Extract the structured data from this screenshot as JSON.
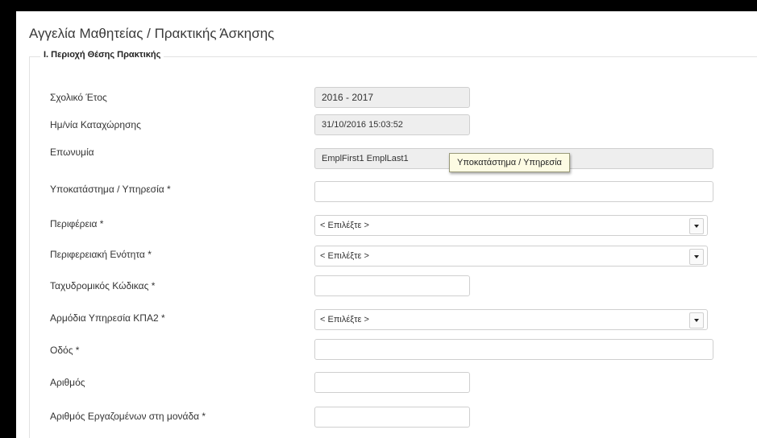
{
  "page_title": "Αγγελία Μαθητείας / Πρακτικής Άσκησης",
  "section": {
    "legend": "I. Περιοχή Θέσης Πρακτικής"
  },
  "fields": {
    "school_year": {
      "label": "Σχολικό Έτος",
      "value": "2016 - 2017"
    },
    "registration_date": {
      "label": "Ημ/νία Καταχώρησης",
      "value": "31/10/2016 15:03:52"
    },
    "company_name": {
      "label": "Επωνυμία",
      "value": "EmplFirst1 EmplLast1"
    },
    "branch": {
      "label": "Υποκατάστημα / Υπηρεσία *",
      "value": ""
    },
    "region": {
      "label": "Περιφέρεια *",
      "value": "< Επιλέξτε >"
    },
    "regional_unit": {
      "label": "Περιφερειακή Ενότητα *",
      "value": "< Επιλέξτε >"
    },
    "postal_code": {
      "label": "Ταχυδρομικός Κώδικας *",
      "value": ""
    },
    "kpa2_service": {
      "label": "Αρμόδια Υπηρεσία ΚΠΑ2 *",
      "value": "< Επιλέξτε >"
    },
    "street": {
      "label": "Οδός *",
      "value": ""
    },
    "street_number": {
      "label": "Αριθμός",
      "value": ""
    },
    "employees": {
      "label": "Αριθμός Εργαζομένων στη μονάδα *",
      "value": ""
    }
  },
  "tooltip": {
    "text": "Υποκατάστημα / Υπηρεσία"
  },
  "icons": {
    "dropdown": "chevron-down-icon"
  },
  "colors": {
    "readonly_bg": "#eeeeee",
    "tooltip_bg": "#fdfbe3"
  }
}
